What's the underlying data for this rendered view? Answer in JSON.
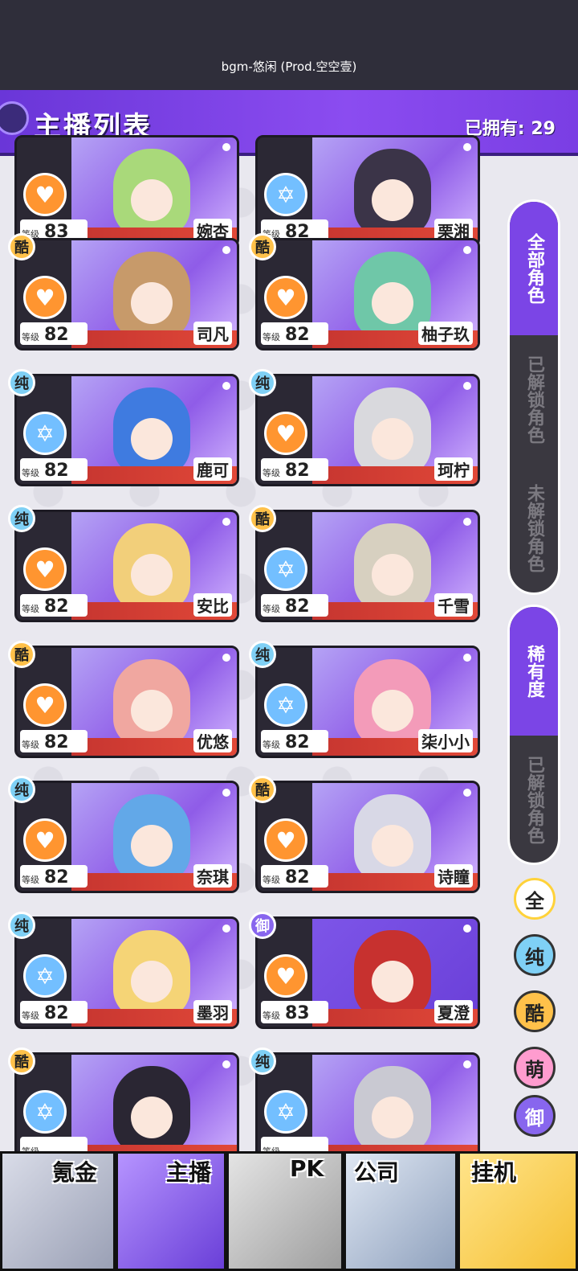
{
  "music": "bgm-悠闲 (Prod.空空壹)",
  "header": {
    "title": "主播列表",
    "owned": "已拥有: 29"
  },
  "level_label": "等级",
  "cards": [
    {
      "name": "婉杏",
      "level": "83",
      "rarity": "",
      "type": "orange"
    },
    {
      "name": "栗湘",
      "level": "82",
      "rarity": "",
      "type": "blue"
    },
    {
      "name": "司凡",
      "level": "82",
      "rarity": "酷",
      "type": "orange"
    },
    {
      "name": "柚子玖",
      "level": "82",
      "rarity": "酷",
      "type": "orange"
    },
    {
      "name": "鹿可",
      "level": "82",
      "rarity": "纯",
      "type": "blue"
    },
    {
      "name": "珂柠",
      "level": "82",
      "rarity": "纯",
      "type": "orange"
    },
    {
      "name": "安比",
      "level": "82",
      "rarity": "纯",
      "type": "orange"
    },
    {
      "name": "千雪",
      "level": "82",
      "rarity": "酷",
      "type": "blue"
    },
    {
      "name": "优悠",
      "level": "82",
      "rarity": "酷",
      "type": "orange"
    },
    {
      "name": "柒小小",
      "level": "82",
      "rarity": "纯",
      "type": "blue"
    },
    {
      "name": "奈琪",
      "level": "82",
      "rarity": "纯",
      "type": "orange"
    },
    {
      "name": "诗瞳",
      "level": "82",
      "rarity": "酷",
      "type": "orange"
    },
    {
      "name": "墨羽",
      "level": "82",
      "rarity": "纯",
      "type": "blue"
    },
    {
      "name": "夏澄",
      "level": "83",
      "rarity": "御",
      "type": "orange"
    },
    {
      "name": "",
      "level": "",
      "rarity": "酷",
      "type": "blue"
    },
    {
      "name": "",
      "level": "",
      "rarity": "纯",
      "type": "blue"
    }
  ],
  "panel1": {
    "active": "全部角色",
    "inactive1": "已解锁角色",
    "inactive2": "未解锁角色"
  },
  "panel2": {
    "active": "稀有度",
    "inactive": "已解锁角色"
  },
  "filters": [
    "全",
    "纯",
    "酷",
    "萌",
    "御"
  ],
  "nav": [
    "氪金",
    "主播",
    "PK",
    "公司",
    "挂机"
  ]
}
